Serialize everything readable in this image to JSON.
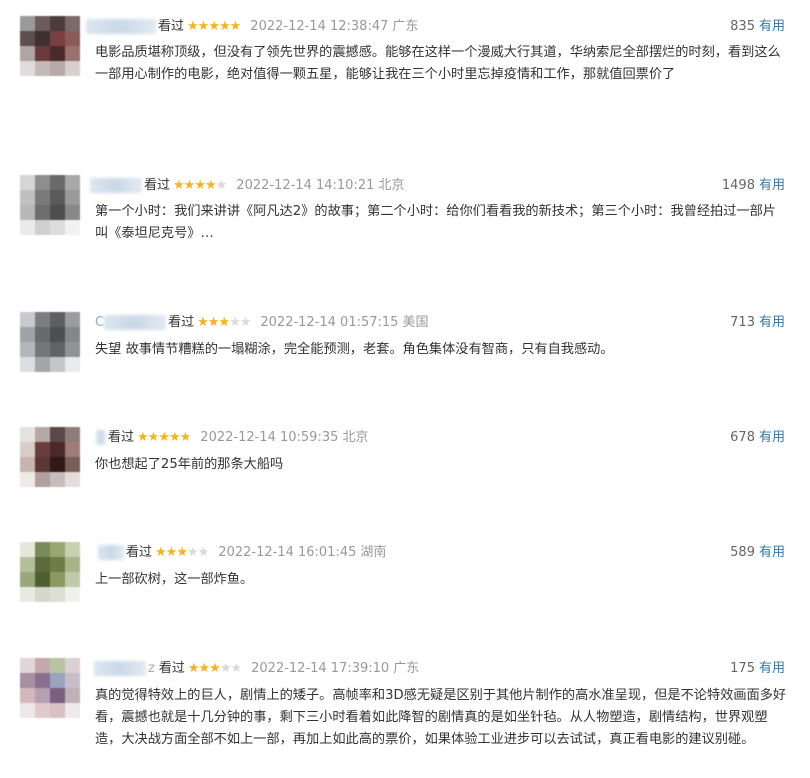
{
  "reviews": [
    {
      "user_suffix": "",
      "watched": "看过",
      "rating": 5,
      "time": "2022-12-14 12:38:47",
      "location": "广东",
      "votes": "835",
      "useful_label": "有用",
      "content": "电影品质堪称顶级，但没有了领先世界的震撼感。能够在这样一个漫威大行其道，华纳索尼全部摆烂的时刻，看到这么一部用心制作的电影，绝对值得一颗五星，能够让我在三个小时里忘掉疫情和工作，那就值回票价了"
    },
    {
      "user_suffix": "",
      "watched": "看过",
      "rating": 4,
      "time": "2022-12-14 14:10:21",
      "location": "北京",
      "votes": "1498",
      "useful_label": "有用",
      "content": "第一个小时：我们来讲讲《阿凡达2》的故事；第二个小时：给你们看看我的新技术；第三个小时：我曾经拍过一部片叫《泰坦尼克号》…"
    },
    {
      "user_suffix": "C",
      "watched": "看过",
      "rating": 3,
      "time": "2022-12-14 01:57:15",
      "location": "美国",
      "votes": "713",
      "useful_label": "有用",
      "content": "失望 故事情节糟糕的一塌糊涂，完全能预测，老套。角色集体没有智商，只有自我感动。"
    },
    {
      "user_suffix": "",
      "watched": "看过",
      "rating": 5,
      "time": "2022-12-14 10:59:35",
      "location": "北京",
      "votes": "678",
      "useful_label": "有用",
      "content": "你也想起了25年前的那条大船吗"
    },
    {
      "user_suffix": "",
      "watched": "看过",
      "rating": 3,
      "time": "2022-12-14 16:01:45",
      "location": "湖南",
      "votes": "589",
      "useful_label": "有用",
      "content": "上一部砍树，这一部炸鱼。"
    },
    {
      "user_suffix": "z",
      "watched": "看过",
      "rating": 3,
      "time": "2022-12-14 17:39:10",
      "location": "广东",
      "votes": "175",
      "useful_label": "有用",
      "content": "真的觉得特效上的巨人，剧情上的矮子。高帧率和3D感无疑是区别于其他片制作的高水准呈现，但是不论特效画面多好看，震撼也就是十几分钟的事，剩下三小时看着如此降智的剧情真的是如坐针毡。从人物塑造，剧情结构，世界观塑造，大决战方面全部不如上一部，再加上如此高的票价，如果体验工业进步可以去试试，真正看电影的建议别碰。"
    }
  ],
  "colors": {
    "star_on": "#f7b21c",
    "star_off": "#d9d9d9",
    "link": "#3377aa"
  },
  "icons": {
    "star": "star-icon",
    "avatar": "avatar-icon"
  }
}
